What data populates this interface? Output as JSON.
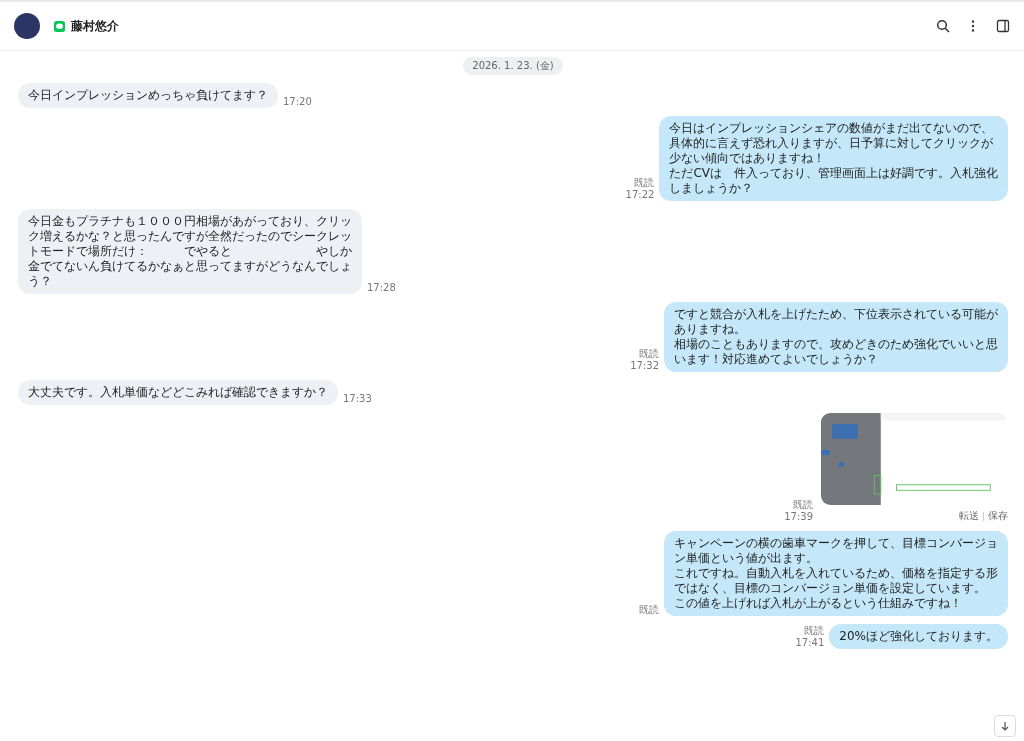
{
  "header": {
    "contact_name": "藤村悠介"
  },
  "date_chip": "2026. 1. 23. (金)",
  "messages": [
    {
      "kind": "incoming",
      "lines": [
        "今日インプレッションめっちゃ負けてます？"
      ],
      "time": "17:20"
    },
    {
      "kind": "outgoing",
      "lines": [
        "今日はインプレッションシェアの数値がまだ出てないので、",
        "具体的に言えず恐れ入りますが、日予算に対してクリックが",
        "少ない傾向ではありますね！",
        "ただCVは　件入っており、管理画面上は好調です。入札強化",
        "しましょうか？"
      ],
      "read_label": "既読",
      "time": "17:22"
    },
    {
      "kind": "incoming",
      "lines": [
        "今日金もプラチナも１０００円相場があがっており、クリッ",
        "ク増えるかな？と思ったんですが全然だったのでシークレッ",
        "トモードで場所だけ：　　　でやると　　　　　　　やしか",
        "金でてないん負けてるかなぁと思ってますがどうなんでしょ",
        "う？"
      ],
      "time": "17:28"
    },
    {
      "kind": "outgoing",
      "lines": [
        "ですと競合が入札を上げたため、下位表示されている可能が",
        "ありますね。",
        "相場のこともありますので、攻めどきのため強化でいいと思",
        "います！対応進めてよいでしょうか？"
      ],
      "read_label": "既読",
      "time": "17:32"
    },
    {
      "kind": "incoming",
      "lines": [
        "大丈夫です。入札単価などどこみれば確認できますか？"
      ],
      "time": "17:33"
    },
    {
      "kind": "outgoing_image",
      "read_label": "既読",
      "time": "17:39",
      "actions": [
        "転送",
        "保存"
      ]
    },
    {
      "kind": "outgoing",
      "lines": [
        "キャンペーンの横の歯車マークを押して、目標コンバージョ",
        "ン単価という値が出ます。",
        "これですね。自動入札を入れているため、価格を指定する形",
        "ではなく、目標のコンバージョン単価を設定しています。",
        "この値を上げれば入札が上がるという仕組みですね！"
      ],
      "read_label": "既読"
    },
    {
      "kind": "outgoing",
      "lines": [
        "20%ほど強化しております。"
      ],
      "read_label": "既読",
      "time": "17:41"
    }
  ]
}
